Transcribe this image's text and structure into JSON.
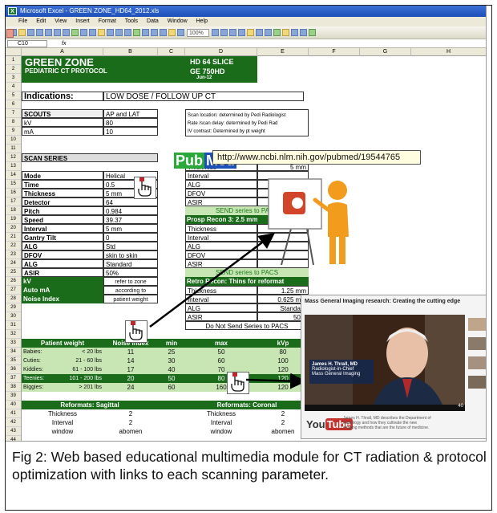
{
  "window": {
    "app_title": "Microsoft Excel - GREEN ZONE_HD64_2012.xls",
    "menus": [
      "File",
      "Edit",
      "View",
      "Insert",
      "Format",
      "Tools",
      "Data",
      "Window",
      "Help"
    ],
    "zoom": "100%",
    "name_box": "C10",
    "fx": "fx"
  },
  "columns": [
    "A",
    "B",
    "C",
    "D",
    "E",
    "F",
    "G",
    "H"
  ],
  "rows": [
    "1",
    "2",
    "3",
    "4",
    "5",
    "6",
    "7",
    "8",
    "9",
    "10",
    "11",
    "12",
    "13",
    "14",
    "15",
    "16",
    "17",
    "18",
    "19",
    "20",
    "21",
    "22",
    "23",
    "24",
    "25",
    "26",
    "27",
    "28",
    "29",
    "30",
    "31",
    "32",
    "33",
    "34",
    "35",
    "36",
    "37",
    "38",
    "39",
    "40",
    "41",
    "42",
    "43",
    "44"
  ],
  "sheet": {
    "title": "GREEN ZONE",
    "subtitle": "PEDIATRIC CT PROTOCOL",
    "scanner": "HD 64 SLICE",
    "model": "GE 750HD",
    "date": "Jun-12",
    "indications_label": "Indications:",
    "indications_value": "LOW DOSE / FOLLOW UP CT",
    "scouts_label": "SCOUTS",
    "scouts_value": "AP and LAT",
    "kv_label": "kV",
    "kv_value": "80",
    "ma_label": "mA",
    "ma_value": "10",
    "notes": [
      "Scan location: determined by Pedi Radiologist",
      "Rate /scan delay: determined by Pedi Rad",
      "IV contrast: Determined by pt weight"
    ],
    "scan_series": "SCAN SERIES",
    "params": [
      {
        "k": "Mode",
        "v": "Helical"
      },
      {
        "k": "Time",
        "v": "0.5"
      },
      {
        "k": "Thickness",
        "v": "5 mm"
      },
      {
        "k": "Detector",
        "v": "64"
      },
      {
        "k": "Pitch",
        "v": "0.984"
      },
      {
        "k": "Speed",
        "v": "39.37"
      },
      {
        "k": "Interval",
        "v": "5 mm"
      },
      {
        "k": "Gantry Tilt",
        "v": "0"
      },
      {
        "k": "ALG",
        "v": "Std"
      },
      {
        "k": "DFOV",
        "v": "skin to skin"
      },
      {
        "k": "ALG",
        "v": "Standard"
      },
      {
        "k": "ASIR",
        "v": "50%"
      }
    ],
    "zone_rows": [
      {
        "k": "kV",
        "v": "refer to zone"
      },
      {
        "k": "Auto mA",
        "v": "according to"
      },
      {
        "k": "Noise Index",
        "v": "patient weight"
      }
    ],
    "recon1": [
      {
        "k": "Thickness",
        "v": "5 mm"
      },
      {
        "k": "Interval",
        "v": ""
      },
      {
        "k": "ALG",
        "v": ""
      },
      {
        "k": "DFOV",
        "v": ""
      },
      {
        "k": "ASIR",
        "v": ""
      }
    ],
    "send1": "SEND series to PACS",
    "recon3_title": "Prosp Recon 3: 2.5 mm",
    "recon3": [
      {
        "k": "Thickness",
        "v": ""
      },
      {
        "k": "Interval",
        "v": ""
      },
      {
        "k": "ALG",
        "v": ""
      },
      {
        "k": "DFOV",
        "v": ""
      },
      {
        "k": "ASIR",
        "v": ""
      }
    ],
    "send2": "SEND series to PACS",
    "recon4_title": "Retro Recon: Thins for reformat",
    "recon4": [
      {
        "k": "Thickness",
        "v": "1.25 mm"
      },
      {
        "k": "Interval",
        "v": "0.625 mm"
      },
      {
        "k": "ALG",
        "v": "Standard"
      },
      {
        "k": "ASIR",
        "v": "50%"
      }
    ],
    "no_send": "Do Not Send Series to PACS",
    "weight_headers": [
      "Patient weight",
      "Noise Index",
      "min",
      "max",
      "kVp"
    ],
    "weight_rows": [
      {
        "name": "Babies:",
        "range": "< 20 lbs",
        "ni": "11",
        "min": "25",
        "max": "50",
        "kvp": "80"
      },
      {
        "name": "Cuties:",
        "range": "21 - 60 lbs",
        "ni": "14",
        "min": "30",
        "max": "60",
        "kvp": "100"
      },
      {
        "name": "Kiddies:",
        "range": "61 - 100 lbs",
        "ni": "17",
        "min": "40",
        "max": "70",
        "kvp": "120"
      },
      {
        "name": "Teenies:",
        "range": "101 - 200 lbs",
        "ni": "20",
        "min": "50",
        "max": "80",
        "kvp": "120"
      },
      {
        "name": "Biggies:",
        "range": "> 201 lbs",
        "ni": "24",
        "min": "60",
        "max": "160",
        "kvp": "120"
      }
    ],
    "reformat_sag": "Reformats: Sagittal",
    "reformat_cor": "Reformats: Coronal",
    "reformat_rows": [
      {
        "k": "Thickness",
        "v": "2"
      },
      {
        "k": "Interval",
        "v": "2"
      },
      {
        "k": "window",
        "v": "abomen"
      }
    ]
  },
  "pubmed": {
    "pub": "Pub",
    "med": "Med",
    "url": "http://www.ncbi.nlm.nih.gov/pubmed/19544765"
  },
  "video": {
    "title": "Mass General Imaging research: Creating the cutting edge",
    "speaker": "James H. Thrall, MD",
    "speaker_role": "Radiologist-in-Chief",
    "speaker_org": "Mass General Imaging",
    "views": "40",
    "you": "You",
    "tube": "Tube",
    "description": "James H. Thrall, MD describes the Department of Radiology and how they cultivate the new imaging methods that are the future of medicine."
  },
  "caption": "Fig 2: Web based educational multimedia module for CT radiation & protocol optimization with links to each scanning parameter."
}
